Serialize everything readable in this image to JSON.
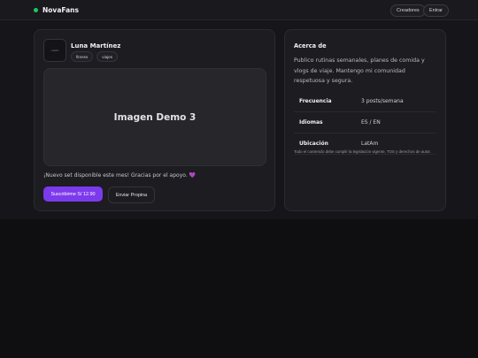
{
  "header": {
    "brand": "NovaFans",
    "nav": {
      "creators": "Creadores",
      "login": "Entrar"
    }
  },
  "profile": {
    "avatar_text": "creator",
    "name": "Luna Martínez",
    "tags": [
      "fitness",
      "viajes"
    ],
    "media_label": "Imagen Demo 3",
    "post_text": "¡Nuevo set disponible este mes! Gracias por el apoyo.",
    "post_emoji": "💜",
    "subscribe_label": "Suscribirme S/ 12.90",
    "tip_label": "Enviar Propina"
  },
  "about": {
    "title": "Acerca de",
    "description": "Publico rutinas semanales, planes de comida y vlogs de viaje. Mantengo mi comunidad respetuosa y segura.",
    "rows": [
      {
        "label": "Frecuencia",
        "value": "3 posts/semana"
      },
      {
        "label": "Idiomas",
        "value": "ES / EN"
      },
      {
        "label": "Ubicación",
        "value": "LatAm"
      }
    ],
    "legal": "Todo el contenido debe cumplir la legislación vigente, TOS y derechos de autor."
  },
  "colors": {
    "accent": "#7c3aed",
    "status_dot": "#22c55e",
    "background": "#16161a"
  }
}
